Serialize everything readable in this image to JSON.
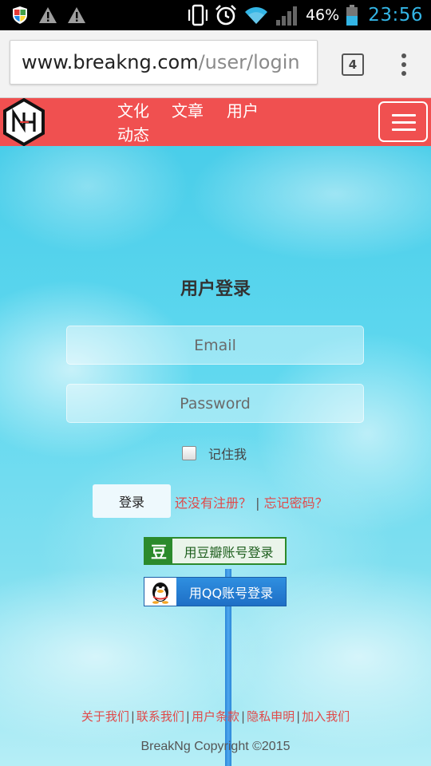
{
  "status_bar": {
    "battery_percent": "46%",
    "time": "23:56",
    "left_icons": [
      "shield-icon",
      "warning-icon",
      "warning-icon"
    ],
    "right_icons": [
      "vibrate-icon",
      "alarm-icon",
      "wifi-icon",
      "signal-icon",
      "battery-icon"
    ]
  },
  "browser": {
    "url_host": "www.breakng.com",
    "url_path": "/user/login",
    "tab_count": "4",
    "menu_icon": "overflow-menu-icon"
  },
  "header": {
    "logo_icon": "breakng-logo",
    "nav": [
      "文化",
      "文章",
      "用户",
      "动态"
    ],
    "menu_icon": "hamburger-icon",
    "colors": {
      "header_bg": "#f05050"
    }
  },
  "login": {
    "title": "用户登录",
    "email_placeholder": "Email",
    "password_placeholder": "Password",
    "remember_label": "记住我",
    "submit_label": "登录",
    "register_link": "还没有注册？",
    "separator": "|",
    "forgot_link": "忘记密码？"
  },
  "social": {
    "douban_logo": "豆",
    "douban_label": "用豆瓣账号登录",
    "qq_label": "用QQ账号登录"
  },
  "footer": {
    "links": [
      "关于我们",
      "联系我们",
      "用户条款",
      "隐私申明",
      "加入我们"
    ],
    "separator": "|",
    "copyright": "BreakNg Copyright ©2015"
  }
}
